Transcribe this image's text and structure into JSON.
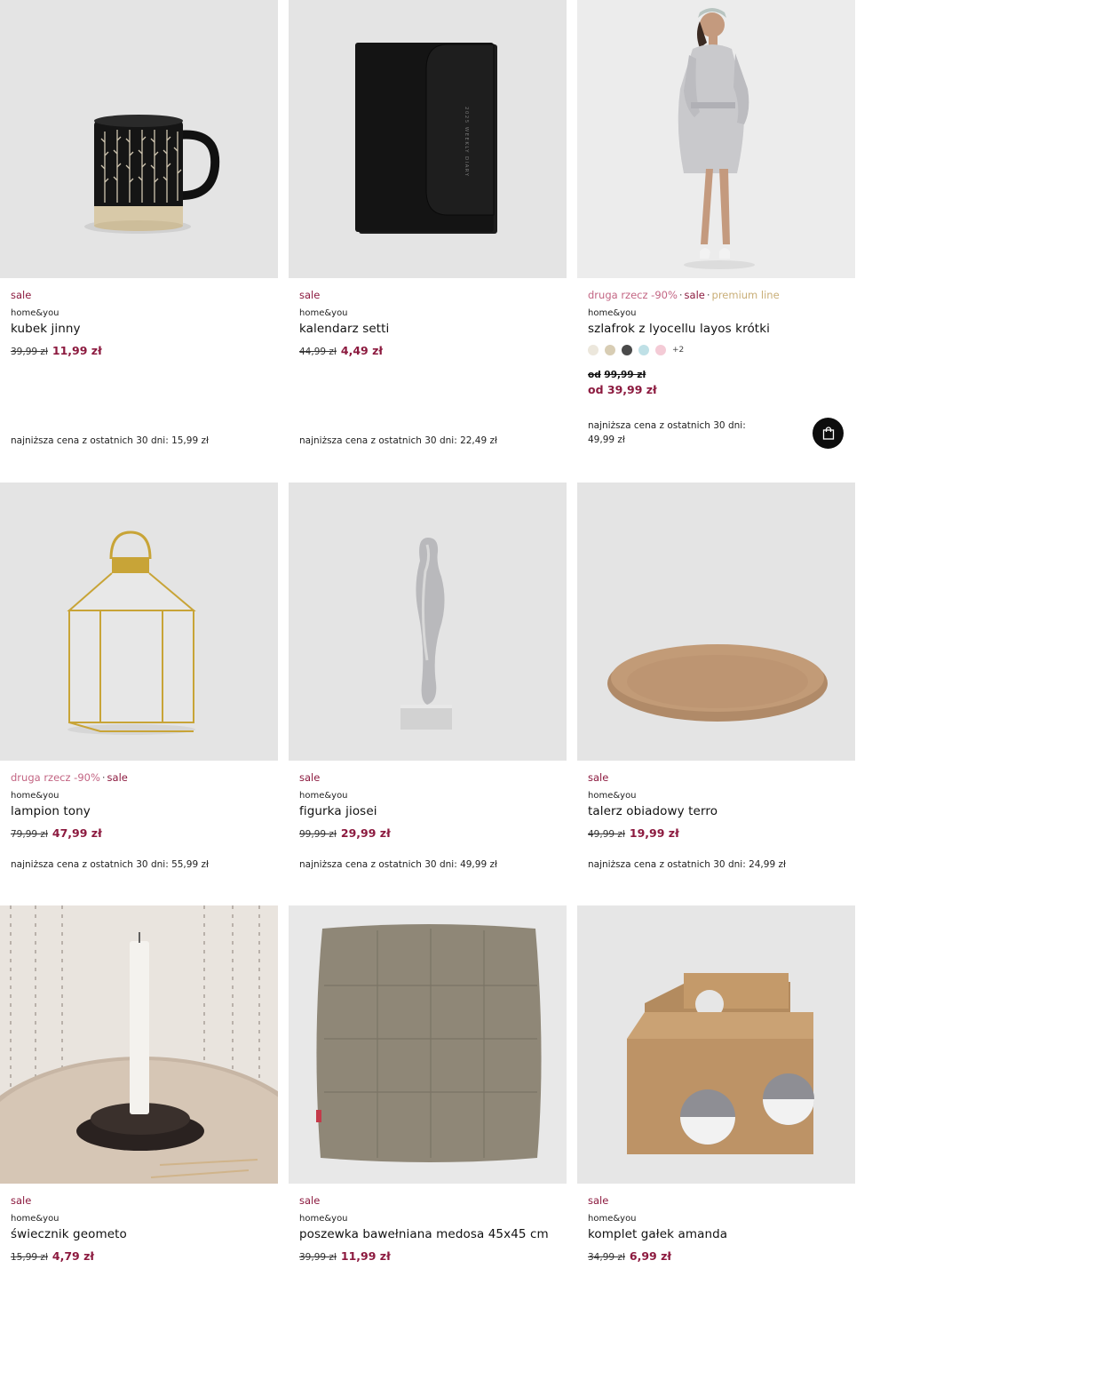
{
  "products": [
    {
      "tags": [
        {
          "text": "sale",
          "kind": "sale"
        }
      ],
      "brand": "home&you",
      "name": "kubek jinny",
      "old_price": "39,99 zł",
      "new_price": "11,99 zł",
      "lowest": "najniższa cena z ostatnich 30 dni: 15,99 zł"
    },
    {
      "tags": [
        {
          "text": "sale",
          "kind": "sale"
        }
      ],
      "brand": "home&you",
      "name": "kalendarz setti",
      "old_price": "44,99 zł",
      "new_price": "4,49 zł",
      "lowest": "najniższa cena z ostatnich 30 dni: 22,49 zł"
    },
    {
      "tags": [
        {
          "text": "druga rzecz -90%",
          "kind": "promo"
        },
        {
          "text": "sale",
          "kind": "sale"
        },
        {
          "text": "premium line",
          "kind": "premium"
        }
      ],
      "brand": "home&you",
      "name": "szlafrok z lyocellu layos krótki",
      "swatch_colors": [
        "#ece7dc",
        "#d8cdb4",
        "#4a4a4a",
        "#bfe0e6",
        "#f4cbd6"
      ],
      "swatch_more": "+2",
      "old_price_prefix": "od",
      "old_price": "99,99 zł",
      "new_price": "od 39,99 zł",
      "lowest_line1": "najniższa cena z ostatnich 30 dni:",
      "lowest_line2": "49,99 zł"
    },
    {
      "tags": [
        {
          "text": "druga rzecz -90%",
          "kind": "promo"
        },
        {
          "text": "sale",
          "kind": "sale"
        }
      ],
      "brand": "home&you",
      "name": "lampion tony",
      "old_price": "79,99 zł",
      "new_price": "47,99 zł",
      "lowest": "najniższa cena z ostatnich 30 dni: 55,99 zł"
    },
    {
      "tags": [
        {
          "text": "sale",
          "kind": "sale"
        }
      ],
      "brand": "home&you",
      "name": "figurka jiosei",
      "old_price": "99,99 zł",
      "new_price": "29,99 zł",
      "lowest": "najniższa cena z ostatnich 30 dni: 49,99 zł"
    },
    {
      "tags": [
        {
          "text": "sale",
          "kind": "sale"
        }
      ],
      "brand": "home&you",
      "name": "talerz obiadowy terro",
      "old_price": "49,99 zł",
      "new_price": "19,99 zł",
      "lowest": "najniższa cena z ostatnich 30 dni: 24,99 zł"
    },
    {
      "tags": [
        {
          "text": "sale",
          "kind": "sale"
        }
      ],
      "brand": "home&you",
      "name": "świecznik geometo",
      "old_price": "15,99 zł",
      "new_price": "4,79 zł"
    },
    {
      "tags": [
        {
          "text": "sale",
          "kind": "sale"
        }
      ],
      "brand": "home&you",
      "name": "poszewka bawełniana medosa 45x45 cm",
      "old_price": "39,99 zł",
      "new_price": "11,99 zł"
    },
    {
      "tags": [
        {
          "text": "sale",
          "kind": "sale"
        }
      ],
      "brand": "home&you",
      "name": "komplet gałek amanda",
      "old_price": "34,99 zł",
      "new_price": "6,99 zł"
    }
  ],
  "calendar_cover_text": "2025 WEEKLY DIARY",
  "colors": {
    "sale": "#8c1a3f",
    "promo": "#c36583",
    "premium": "#c9ae77",
    "image_bg": "#e3e3e3"
  },
  "icons": {
    "cart_button": "shopping-bag-icon"
  }
}
